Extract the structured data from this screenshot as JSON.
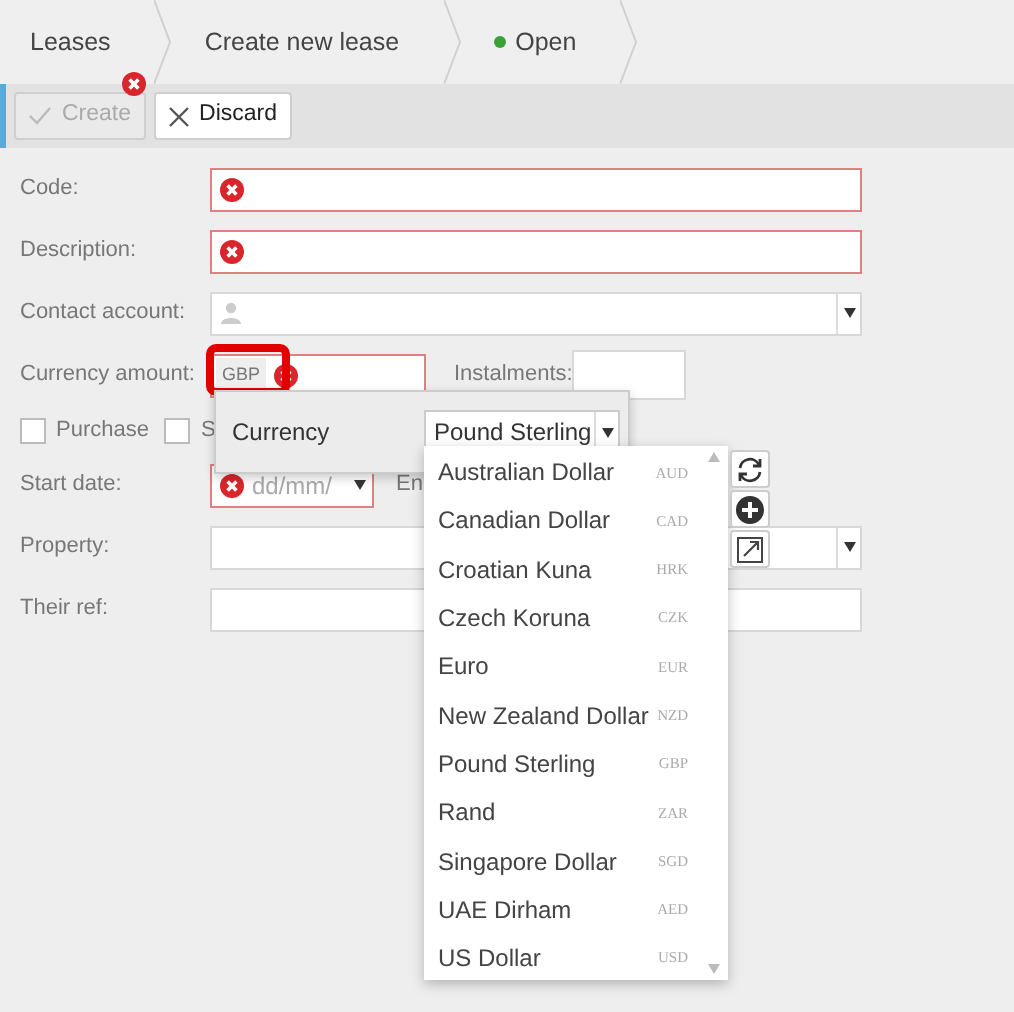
{
  "breadcrumb": [
    {
      "label": "Leases",
      "kind": "link"
    },
    {
      "label": "Create new lease",
      "kind": "link"
    },
    {
      "label": "Open",
      "kind": "status",
      "color": "#3aa03a"
    }
  ],
  "toolbar": [
    {
      "label": "Create",
      "disabled": true,
      "error": true
    },
    {
      "label": "Discard",
      "disabled": false,
      "error": false
    }
  ],
  "form": [
    {
      "kind": "text",
      "label": "Code:",
      "error": true
    },
    {
      "kind": "text",
      "label": "Description:",
      "error": true
    },
    {
      "kind": "lookup",
      "label": "Contact account:",
      "error": false
    },
    {
      "kind": "currency",
      "label": "Currency amount:",
      "currency": "GBP",
      "error": true,
      "highlighted": true,
      "extra_label": "Instalments:"
    },
    {
      "kind": "checks",
      "items": [
        {
          "label": "Purchase",
          "checked": false
        },
        {
          "label": "S",
          "checked": false
        }
      ]
    },
    {
      "kind": "date",
      "label": "Start date:",
      "placeholder": "dd/mm/",
      "error": true,
      "extra_label": "En"
    },
    {
      "kind": "select",
      "label": "Property:",
      "error": false
    },
    {
      "kind": "text",
      "label": "Their ref:",
      "error": false
    }
  ],
  "currency_popover": {
    "label": "Currency",
    "value": "Pound Sterling"
  },
  "currency_options": [
    {
      "name": "Australian Dollar",
      "code": "AUD"
    },
    {
      "name": "Canadian Dollar",
      "code": "CAD"
    },
    {
      "name": "Croatian Kuna",
      "code": "HRK"
    },
    {
      "name": "Czech Koruna",
      "code": "CZK"
    },
    {
      "name": "Euro",
      "code": "EUR"
    },
    {
      "name": "New Zealand Dollar",
      "code": "NZD"
    },
    {
      "name": "Pound Sterling",
      "code": "GBP"
    },
    {
      "name": "Rand",
      "code": "ZAR"
    },
    {
      "name": "Singapore Dollar",
      "code": "SGD"
    },
    {
      "name": "UAE Dirham",
      "code": "AED"
    },
    {
      "name": "US Dollar",
      "code": "USD"
    }
  ]
}
